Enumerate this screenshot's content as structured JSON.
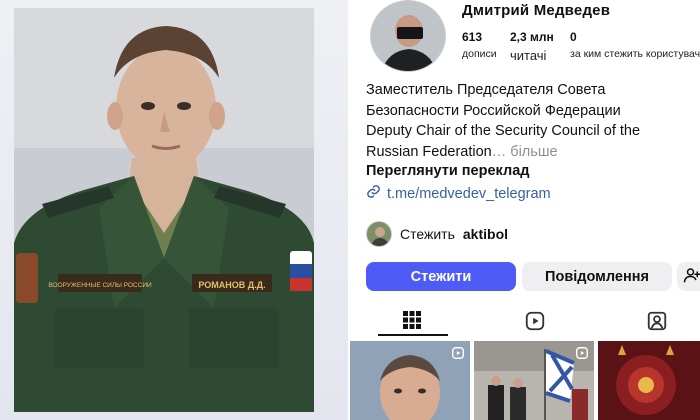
{
  "profile": {
    "name": "Дмитрий Медведев",
    "stats": [
      {
        "num": "613",
        "label": "дописи"
      },
      {
        "num": "2,3 млн",
        "label": "читачі"
      },
      {
        "num": "0",
        "label": "за ким стежить користувач"
      }
    ],
    "bio_lines": [
      "Заместитель Председателя Совета",
      "Безопасности Российской Федерации",
      "Deputy Chair of the Security Council of the",
      "Russian Federation"
    ],
    "bio_more": "… більше",
    "translate": "Переглянути переклад",
    "link": "t.me/medvedev_telegram",
    "followed_by_prefix": "Стежить",
    "followed_by_user": "aktibol"
  },
  "buttons": {
    "follow": "Стежити",
    "message": "Повідомлення"
  },
  "icons": {
    "link": "link-icon",
    "add_user": "add-user-icon",
    "grid_tab": "grid-icon",
    "reels_tab": "reels-icon",
    "tagged_tab": "tagged-icon",
    "reel_badge": "reel-badge-icon"
  },
  "left_photo": {
    "chevron_patch": "ВООРУЖЕННЫЕ СИЛЫ РОССИИ",
    "name_tag": "РОМАНОВ Д.Д."
  },
  "colors": {
    "follow_button": "#4f5bf5",
    "link": "#3a5fa0",
    "uniform": "#2f4a32"
  }
}
